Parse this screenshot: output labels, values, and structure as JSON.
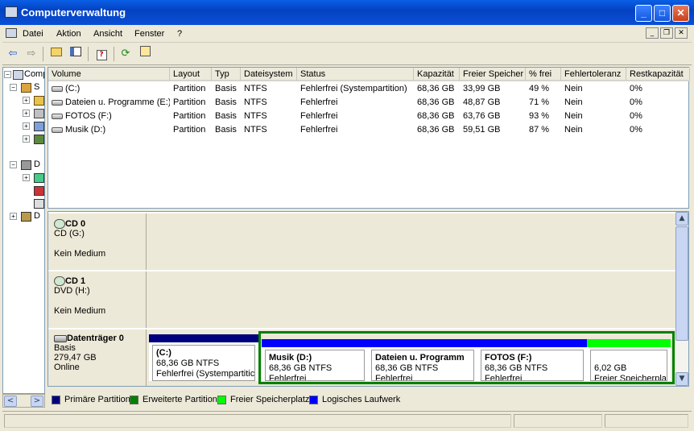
{
  "window": {
    "title": "Computerverwaltung"
  },
  "menu": [
    "Datei",
    "Aktion",
    "Ansicht",
    "Fenster",
    "?"
  ],
  "tree": {
    "root": "Comp",
    "items": [
      "S",
      "D",
      "D"
    ]
  },
  "volumes": {
    "columns": [
      "Volume",
      "Layout",
      "Typ",
      "Dateisystem",
      "Status",
      "Kapazität",
      "Freier Speicher",
      "% frei",
      "Fehlertoleranz",
      "Restkapazität"
    ],
    "rows": [
      [
        "(C:)",
        "Partition",
        "Basis",
        "NTFS",
        "Fehlerfrei (Systempartition)",
        "68,36 GB",
        "33,99 GB",
        "49 %",
        "Nein",
        "0%"
      ],
      [
        "Dateien u. Programme (E:)",
        "Partition",
        "Basis",
        "NTFS",
        "Fehlerfrei",
        "68,36 GB",
        "48,87 GB",
        "71 %",
        "Nein",
        "0%"
      ],
      [
        "FOTOS (F:)",
        "Partition",
        "Basis",
        "NTFS",
        "Fehlerfrei",
        "68,36 GB",
        "63,76 GB",
        "93 %",
        "Nein",
        "0%"
      ],
      [
        "Musik  (D:)",
        "Partition",
        "Basis",
        "NTFS",
        "Fehlerfrei",
        "68,36 GB",
        "59,51 GB",
        "87 %",
        "Nein",
        "0%"
      ]
    ]
  },
  "disks": [
    {
      "name": "CD 0",
      "type": "CD (G:)",
      "status": "Kein Medium"
    },
    {
      "name": "CD 1",
      "type": "DVD (H:)",
      "status": "Kein Medium"
    },
    {
      "name": "Datenträger 0",
      "type": "Basis",
      "size": "279,47 GB",
      "status": "Online"
    }
  ],
  "partitions": [
    {
      "name": "(C:)",
      "size": "68,36 GB NTFS",
      "status": "Fehlerfrei (Systempartitic",
      "color": "#00007f"
    },
    {
      "name": "Musik   (D:)",
      "size": "68,36 GB NTFS",
      "status": "Fehlerfrei",
      "color": "#0000ff"
    },
    {
      "name": "Dateien u. Programm",
      "size": "68,36 GB NTFS",
      "status": "Fehlerfrei",
      "color": "#0000ff"
    },
    {
      "name": "FOTOS  (F:)",
      "size": "68,36 GB NTFS",
      "status": "Fehlerfrei",
      "color": "#0000ff"
    },
    {
      "name": "",
      "size": "6,02 GB",
      "status": "Freier Speicherplat",
      "color": "#00ff00"
    }
  ],
  "legend": [
    {
      "label": "Primäre Partition",
      "color": "#00007f"
    },
    {
      "label": "Erweiterte Partition",
      "color": "#008000"
    },
    {
      "label": "Freier Speicherplatz",
      "color": "#00ff00"
    },
    {
      "label": "Logisches Laufwerk",
      "color": "#0000ff"
    }
  ],
  "colors": {
    "extended_border": "#008000"
  }
}
